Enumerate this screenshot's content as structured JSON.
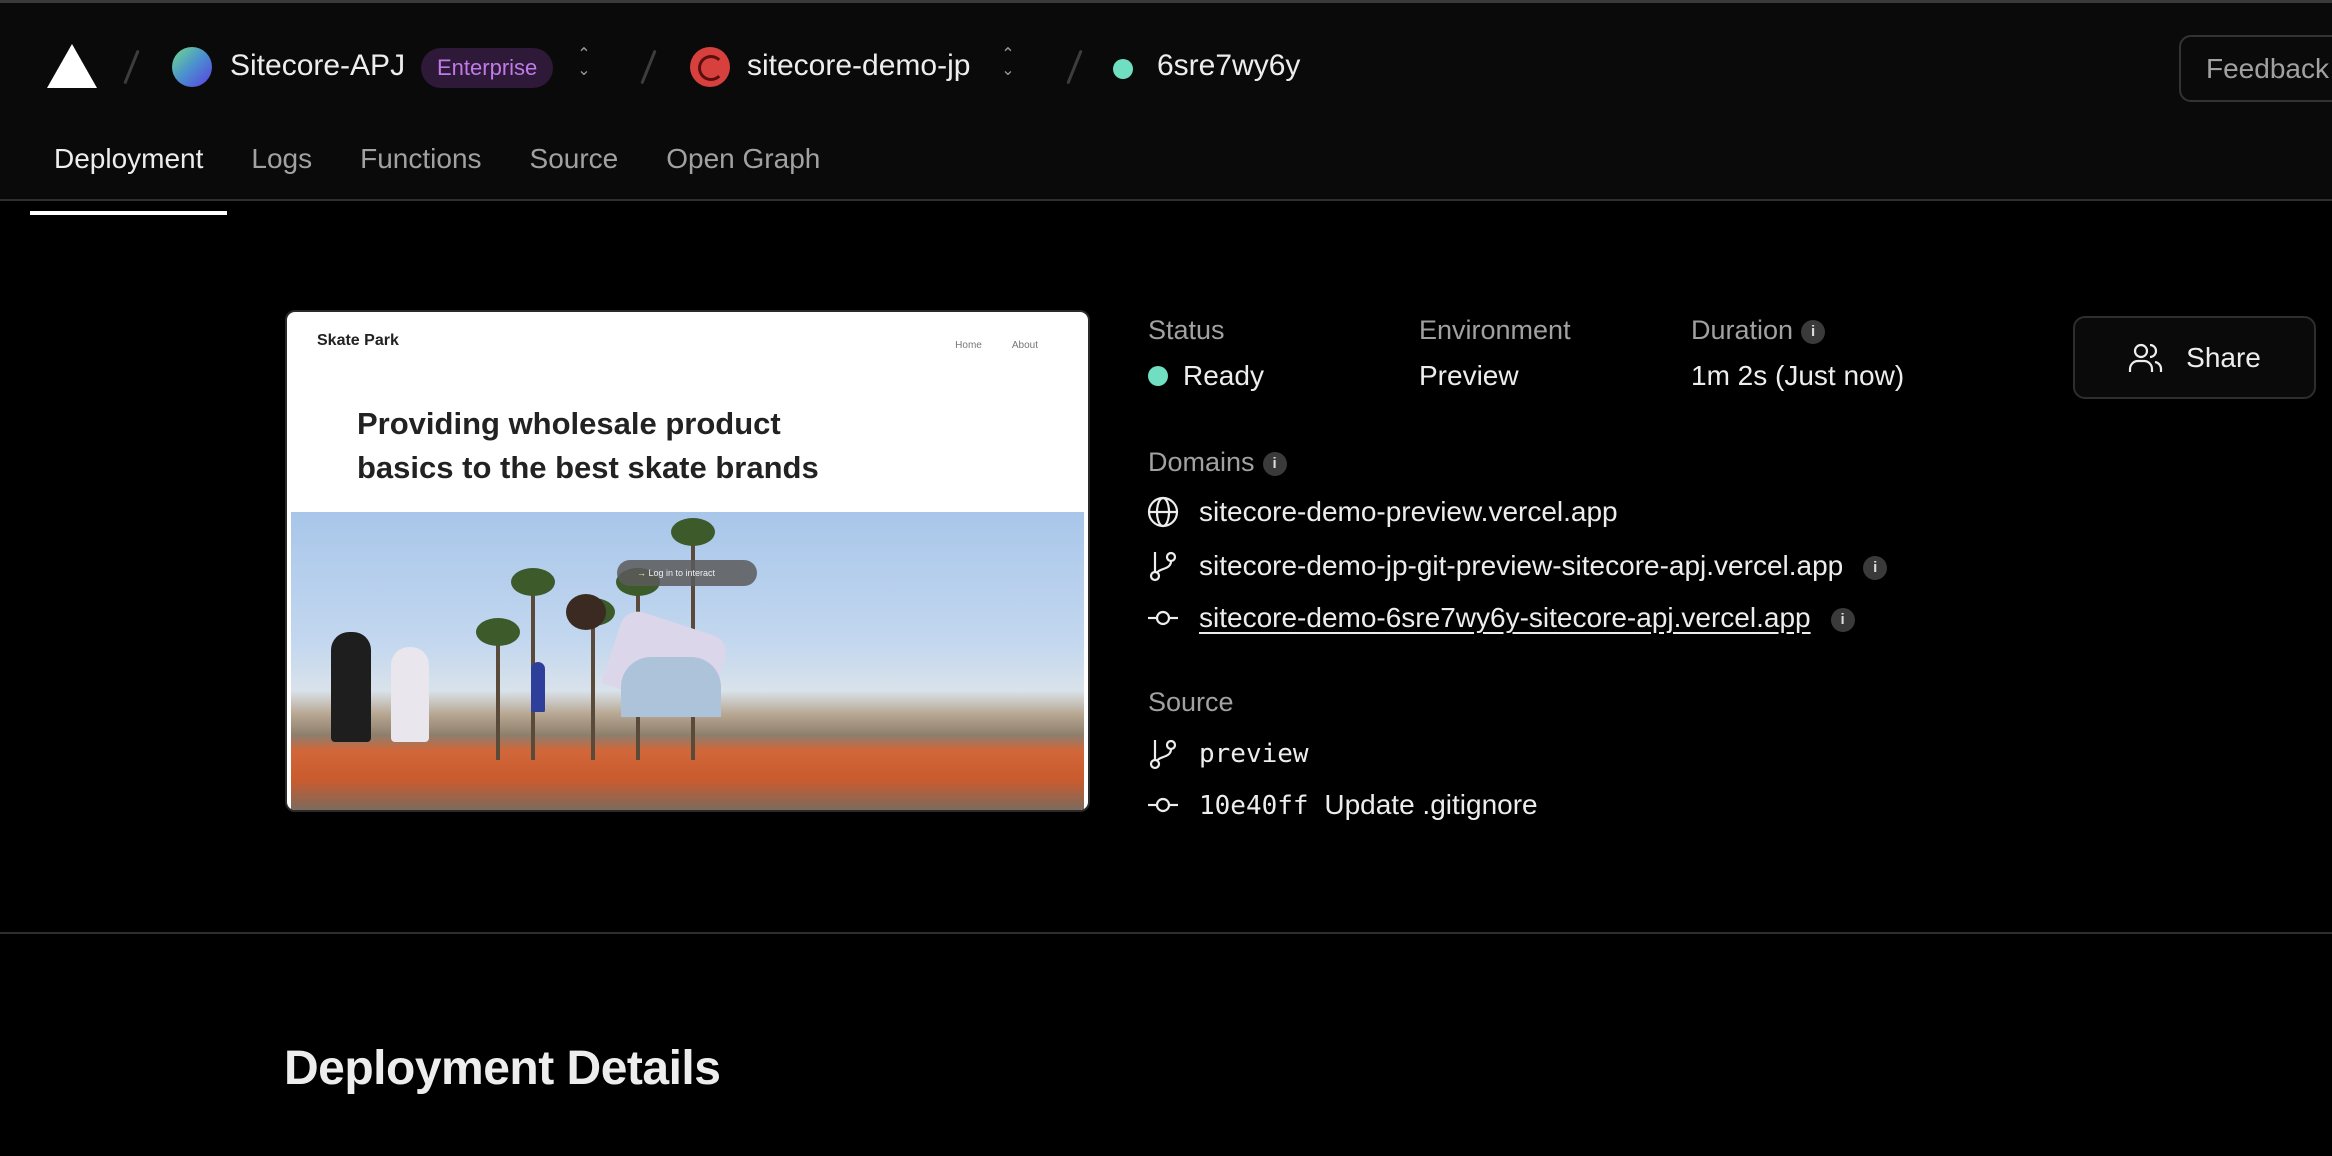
{
  "header": {
    "team": {
      "name": "Sitecore-APJ",
      "plan_badge": "Enterprise"
    },
    "project": {
      "name": "sitecore-demo-jp"
    },
    "deployment": {
      "id": "6sre7wy6y",
      "status_color": "#6fdec1"
    },
    "feedback_label": "Feedback"
  },
  "tabs": [
    {
      "label": "Deployment",
      "active": true
    },
    {
      "label": "Logs"
    },
    {
      "label": "Functions"
    },
    {
      "label": "Source"
    },
    {
      "label": "Open Graph"
    }
  ],
  "preview": {
    "site_brand": "Skate Park",
    "nav": [
      "Home",
      "About"
    ],
    "hero_text": "Providing wholesale product basics to the best skate brands",
    "overlay_label": "Log in to interact"
  },
  "info": {
    "status": {
      "label": "Status",
      "value": "Ready",
      "color": "#6fdec1"
    },
    "environment": {
      "label": "Environment",
      "value": "Preview"
    },
    "duration": {
      "label": "Duration",
      "value": "1m 2s (Just now)"
    },
    "share_label": "Share"
  },
  "domains": {
    "label": "Domains",
    "items": [
      {
        "icon": "globe-icon",
        "text": "sitecore-demo-preview.vercel.app"
      },
      {
        "icon": "git-branch-icon",
        "text": "sitecore-demo-jp-git-preview-sitecore-apj.vercel.app"
      },
      {
        "icon": "git-commit-icon",
        "text": "sitecore-demo-6sre7wy6y-sitecore-apj.vercel.app"
      }
    ]
  },
  "source": {
    "label": "Source",
    "branch": "preview",
    "commit_sha": "10e40ff",
    "commit_message": "Update .gitignore"
  },
  "section": {
    "title": "Deployment Details"
  },
  "icons": {
    "info": "i"
  }
}
